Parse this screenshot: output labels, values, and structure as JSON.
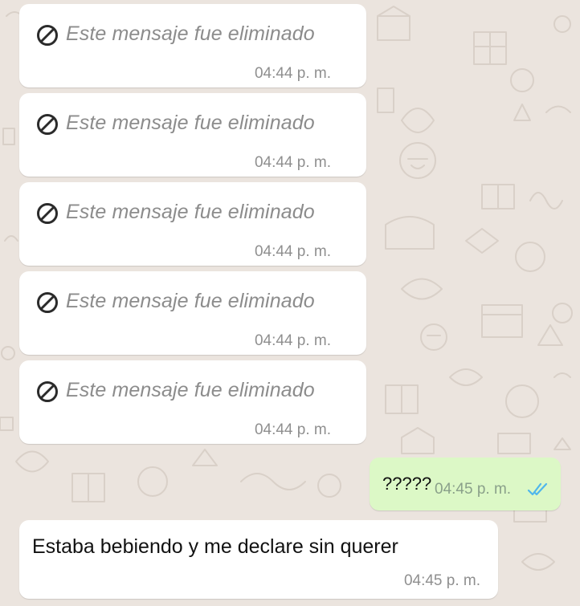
{
  "colors": {
    "chat_background": "#ebe4de",
    "incoming_bubble": "#ffffff",
    "outgoing_bubble": "#dcf8c6",
    "read_ticks": "#4fb6ec",
    "deleted_text": "#8c8c8c"
  },
  "messages": [
    {
      "direction": "incoming",
      "deleted": true,
      "icon": "ban-icon",
      "text": "Este mensaje fue eliminado",
      "time": "04:44 p. m."
    },
    {
      "direction": "incoming",
      "deleted": true,
      "icon": "ban-icon",
      "text": "Este mensaje fue eliminado",
      "time": "04:44 p. m."
    },
    {
      "direction": "incoming",
      "deleted": true,
      "icon": "ban-icon",
      "text": "Este mensaje fue eliminado",
      "time": "04:44 p. m."
    },
    {
      "direction": "incoming",
      "deleted": true,
      "icon": "ban-icon",
      "text": "Este mensaje fue eliminado",
      "time": "04:44 p. m."
    },
    {
      "direction": "incoming",
      "deleted": true,
      "icon": "ban-icon",
      "text": "Este mensaje fue eliminado",
      "time": "04:44 p. m."
    },
    {
      "direction": "outgoing",
      "deleted": false,
      "text": "?????",
      "time": "04:45 p. m.",
      "status_icon": "double-check-icon",
      "status": "read"
    },
    {
      "direction": "incoming",
      "deleted": false,
      "text": "Estaba bebiendo y me declare sin querer",
      "time": "04:45 p. m."
    }
  ]
}
